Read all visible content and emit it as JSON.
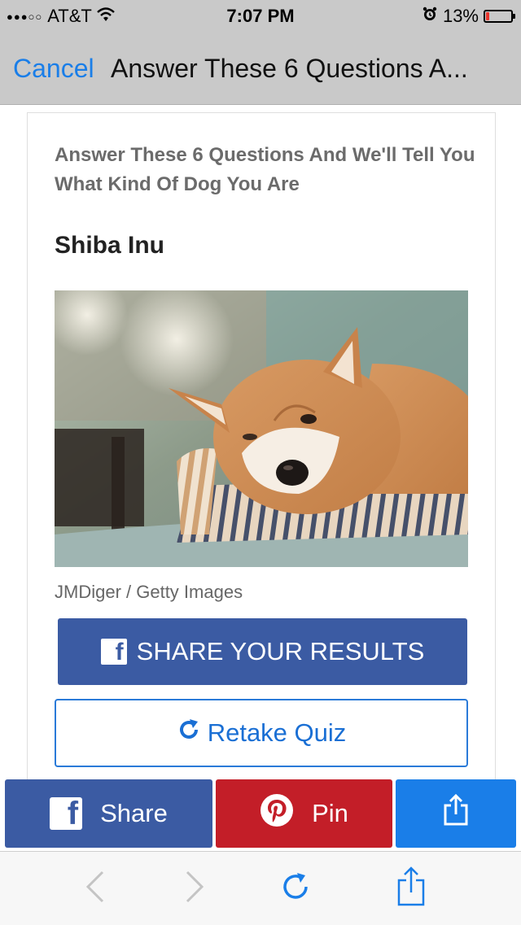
{
  "status_bar": {
    "signal_dots": "●●●○○",
    "carrier": "AT&T",
    "time": "7:07 PM",
    "battery_percent": "13%",
    "battery_level": 0.13
  },
  "nav": {
    "cancel_label": "Cancel",
    "title": "Answer These 6 Questions A..."
  },
  "content": {
    "quiz_title": "Answer These 6 Questions And We'll Tell You What Kind Of Dog You Are",
    "result": "Shiba Inu",
    "photo_credit": "JMDiger / Getty Images",
    "share_results_label": "SHARE YOUR RESULTS",
    "retake_label": "Retake Quiz"
  },
  "share_bar": {
    "facebook_label": "Share",
    "pinterest_label": "Pin"
  },
  "icons": {
    "facebook": "facebook-icon",
    "pinterest": "pinterest-icon",
    "share": "share-icon",
    "refresh": "refresh-icon",
    "back": "chevron-left-icon",
    "forward": "chevron-right-icon",
    "alarm": "alarm-icon",
    "wifi": "wifi-icon"
  },
  "colors": {
    "accent": "#1a7ee8",
    "facebook": "#3b5ba3",
    "pinterest": "#c31e28",
    "battery_low": "#e8352c"
  }
}
